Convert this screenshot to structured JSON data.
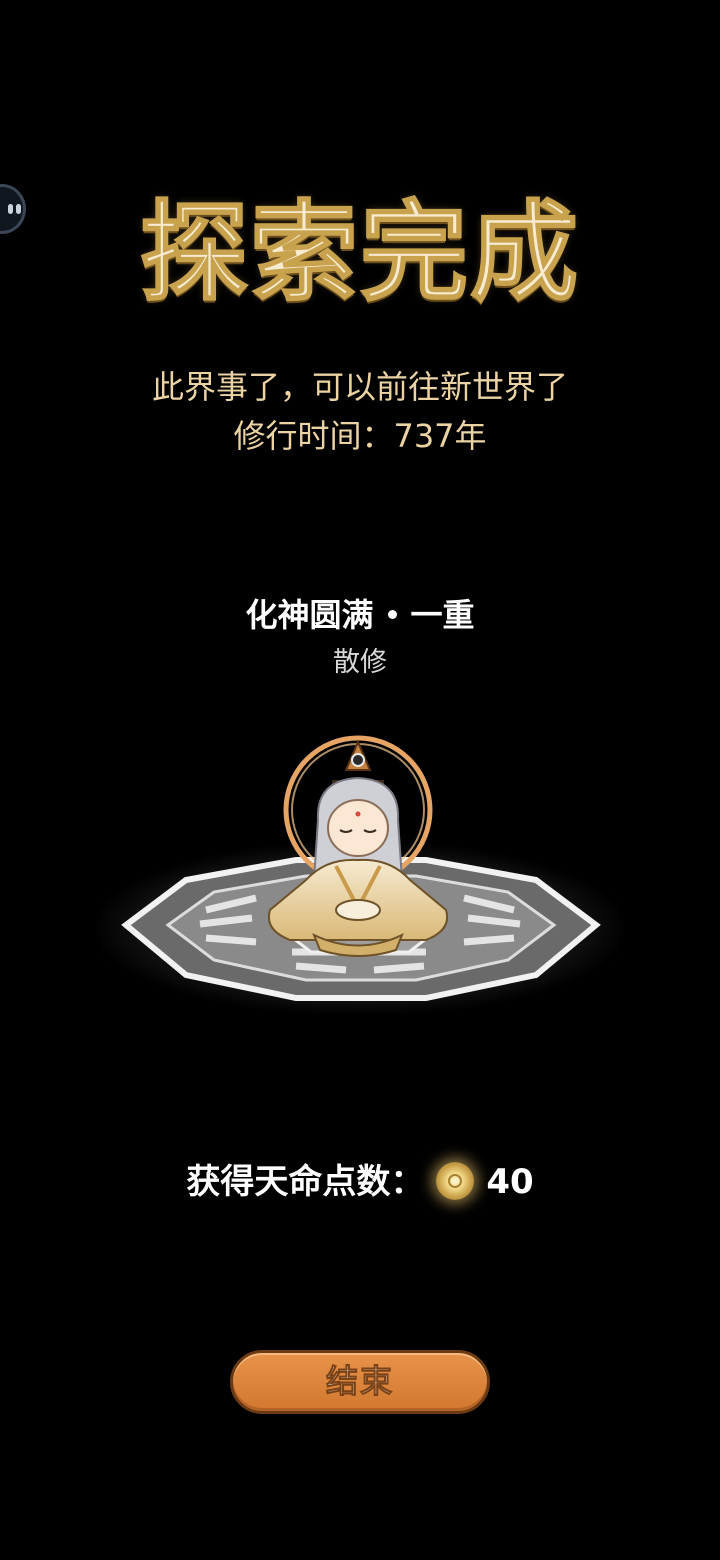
{
  "title": "探索完成",
  "subtitle": {
    "line1": "此界事了，可以前往新世界了",
    "line2": "修行时间：737年"
  },
  "character": {
    "rank_main": "化神圆满",
    "rank_tier": "一重",
    "faction": "散修"
  },
  "reward": {
    "label": "获得天命点数：",
    "value": "40",
    "icon": "destiny-coin-icon"
  },
  "end_button": {
    "label": "结束"
  },
  "colors": {
    "background": "#000000",
    "title": "#f7ecd2",
    "subtitle": "#ebd3a4",
    "button": "#e08a42"
  }
}
